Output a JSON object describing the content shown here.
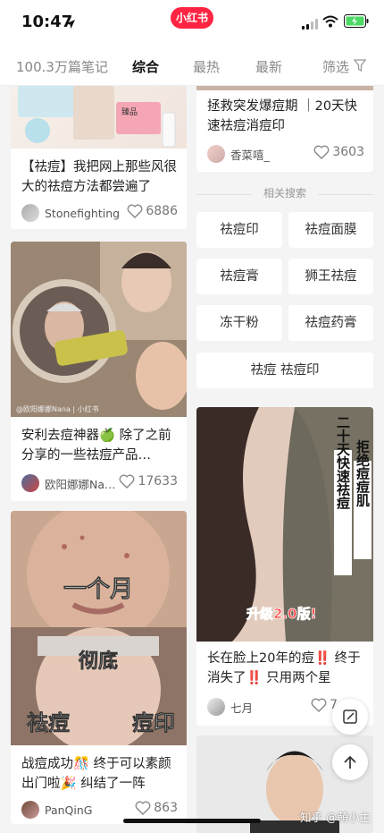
{
  "status_bar": {
    "time": "10:47"
  },
  "app_badge": "小红书",
  "tabs": {
    "count": "100.3万篇笔记",
    "items": [
      "综合",
      "最热",
      "最新"
    ],
    "filter": "筛选"
  },
  "left_column": [
    {
      "title": "【祛痘】我把网上那些风很大的祛痘方法都尝遍了",
      "author": "Stonefighting",
      "likes": "6886"
    },
    {
      "title": "安利去痘神器🍏 除了之前分享的一些祛痘产品…",
      "author": "欧阳娜娜Na…",
      "likes": "17633"
    },
    {
      "title": "战痘成功🎊 终于可以素颜出门啦🎉 纠结了一阵",
      "author": "PanQinG",
      "likes": "863"
    }
  ],
  "left_images": {
    "product_label": "臻品",
    "photo_watermark": "@欧阳娜娜Nana | 小红书",
    "overlay_lines": [
      "一个月",
      "彻底",
      "祛痘",
      "痘印"
    ]
  },
  "right_column": {
    "top_card": {
      "title": "拯救突发爆痘期 ｜20天快速祛痘消痘印",
      "author": "香菜嘻_",
      "likes": "3603"
    },
    "related_heading": "相关搜索",
    "related": [
      "祛痘印",
      "祛痘面膜",
      "祛痘膏",
      "狮王祛痘",
      "冻干粉",
      "祛痘药膏",
      "祛痘 祛痘印"
    ],
    "card2": {
      "overlay_vertical_1": "拒绝痘痘肌",
      "overlay_vertical_2": "二十天快速祛痘",
      "overlay_badge": "升级2.0版!",
      "title": "长在脸上20年的痘‼️ 终于消失了‼️ 只用两个星",
      "author": "七月",
      "likes": "7"
    }
  },
  "watermark": "知乎 @萌小主",
  "colors": {
    "brand": "#ff2442",
    "background": "#f4f4f4",
    "text": "#222222",
    "muted": "#888888"
  },
  "icons": [
    "location-arrow-icon",
    "signal-icon",
    "wifi-icon",
    "battery-icon",
    "filter-icon",
    "heart-icon",
    "edit-icon",
    "back-to-top-icon"
  ]
}
